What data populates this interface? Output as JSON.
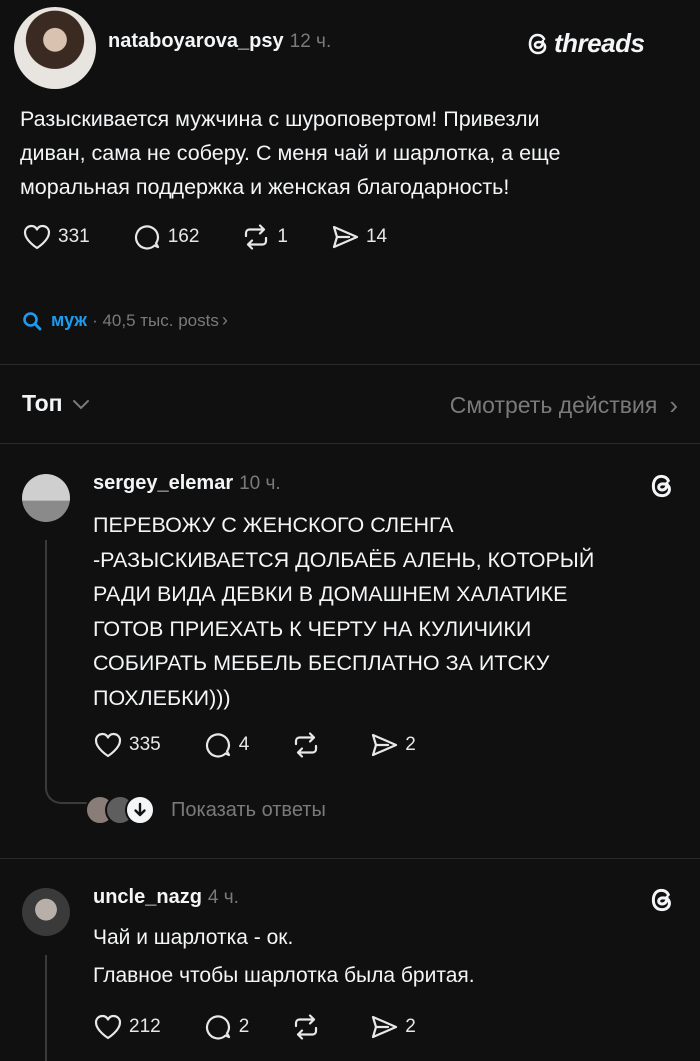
{
  "post": {
    "username": "nataboyarova_psy",
    "time": "12 ч.",
    "brand": "threads",
    "text": "Разыскивается мужчина с шуроповертом! Привезли\nдиван, сама не соберу. С меня чай и шарлотка, а еще\nморальная поддержка и женская благодарность!",
    "likes": "331",
    "comments": "162",
    "reposts": "1",
    "shares": "14"
  },
  "topic": {
    "tag": "муж",
    "meta": "· 40,5 тыс. posts",
    "chevron": "›"
  },
  "sort": {
    "label": "Топ",
    "view_activity": "Смотреть действия",
    "chevron": "›"
  },
  "replies": [
    {
      "username": "sergey_elemar",
      "time": "10 ч.",
      "text": "ПЕРЕВОЖУ С ЖЕНСКОГО СЛЕНГА\n-РАЗЫСКИВАЕТСЯ ДОЛБАЁБ АЛЕНЬ, КОТОРЫЙ\nРАДИ ВИДА ДЕВКИ В ДОМАШНЕМ ХАЛАТИКЕ\nГОТОВ ПРИЕХАТЬ К ЧЕРТУ НА КУЛИЧИКИ\nСОБИРАТЬ МЕБЕЛЬ БЕСПЛАТНО ЗА ИТСКУ\nПОХЛЕБКИ)))",
      "likes": "335",
      "comments": "4",
      "reposts": "",
      "shares": "2",
      "show_replies": "Показать ответы"
    },
    {
      "username": "uncle_nazg",
      "time": "4 ч.",
      "text_line1": "Чай и шарлотка - ок.",
      "text_line2": "Главное чтобы шарлотка была бритая.",
      "likes": "212",
      "comments": "2",
      "reposts": "",
      "shares": "2"
    }
  ],
  "icons": {
    "like": "heart-icon",
    "comment": "comment-icon",
    "repost": "repost-icon",
    "share": "send-icon",
    "threads": "threads-logo-icon",
    "search": "search-icon"
  },
  "colors": {
    "background": "#101010",
    "text": "#f3f5f7",
    "muted": "#7a7a7a",
    "link": "#1d9bf0"
  }
}
